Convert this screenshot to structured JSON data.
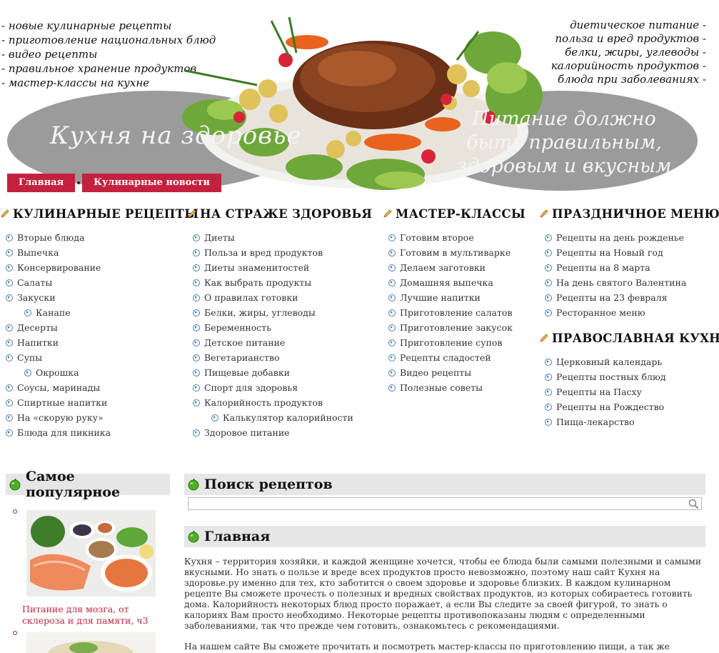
{
  "header": {
    "links_left": [
      "- новые кулинарные рецепты",
      "- приготовление национальных блюд",
      "- видео рецепты",
      "- правильное хранение продуктов",
      "- мастер-классы на кухне"
    ],
    "links_right": [
      "диетическое питание -",
      "польза и вред продуктов -",
      "белки, жиры, углеводы -",
      "калорийность продуктов -",
      "блюда при заболеваниях -"
    ],
    "site_title": "Кухня на здоровье",
    "slogan": "Питание должно быть правильным, здоровым и вкусным",
    "nav": {
      "home": "Главная",
      "news": "Кулинарные новости"
    }
  },
  "menu": {
    "recipes": {
      "title": "КУЛИНАРНЫЕ РЕЦЕПТЫ",
      "items": [
        "Вторые блюда",
        "Выпечка",
        "Консервирование",
        "Салаты",
        "Закуски",
        "Канапе",
        "Десерты",
        "Напитки",
        "Супы",
        "Окрошка",
        "Соусы, маринады",
        "Спиртные напитки",
        "На «скорую руку»",
        "Блюда для пикника"
      ]
    },
    "health": {
      "title": "НА СТРАЖЕ ЗДОРОВЬЯ",
      "items": [
        "Диеты",
        "Польза и вред продуктов",
        "Диеты знаменитостей",
        "Как выбрать продукты",
        "О правилах готовки",
        "Белки, жиры, углеводы",
        "Беременность",
        "Детское питание",
        "Вегетарианство",
        "Пищевые добавки",
        "Спорт для здоровья",
        "Калорийность продуктов",
        "Калькулятор калорийности",
        "Здоровое питание"
      ]
    },
    "masterclasses": {
      "title": "МАСТЕР-КЛАССЫ",
      "items": [
        "Готовим второе",
        "Готовим в мультиварке",
        "Делаем заготовки",
        "Домашняя выпечка",
        "Лучшие напитки",
        "Приготовление салатов",
        "Приготовление закусок",
        "Приготовление супов",
        "Рецепты сладостей",
        "Видео рецепты",
        "Полезные советы"
      ]
    },
    "holiday": {
      "title": "ПРАЗДНИЧНОЕ МЕНЮ",
      "items": [
        "Рецепты на день рожденье",
        "Рецепты на Новый год",
        "Рецепты на 8 марта",
        "На день святого Валентина",
        "Рецепты на 23 февраля",
        "Ресторанное меню"
      ]
    },
    "orthodox": {
      "title": "ПРАВОСЛАВНАЯ КУХНЯ",
      "items": [
        "Церковный календарь",
        "Рецепты постных блюд",
        "Рецепты на Пасху",
        "Рецепты на Рождество",
        "Пища-лекарство"
      ]
    }
  },
  "popular": {
    "title": "Самое популярное",
    "item1_caption": "Питание для мозга, от склероза и для памяти, ч3"
  },
  "search": {
    "title": "Поиск рецептов",
    "value": ""
  },
  "main": {
    "title": "Главная",
    "p1": "Кухня – территория хозяйки, и каждой женщине хочется, чтобы ее блюда были самыми полезными и самыми вкусными. Но знать о пользе и вреде всех продуктов просто невозможно, поэтому наш сайт Кухня на здоровье.ру именно для тех, кто заботится о своем здоровье и здоровье близких. В каждом кулинарном рецепте Вы сможете прочесть о полезных и вредных свойствах продуктов, из которых собираетесь готовить дома. Калорийность некоторых блюд просто поражает, а если Вы следите за своей фигурой, то знать о калориях Вам просто необходимо. Некоторые рецепты противопоказаны людям с определенными заболеваниями, так что прежде чем готовить, ознакомьтесь с рекомендациями.",
    "p2": "На нашем сайте Вы сможете прочитать и посмотреть мастер-классы по приготовлению пищи, а так же изучить видео"
  },
  "colors": {
    "accent": "#c4213f",
    "oval": "#9b9b9b",
    "box_bg": "#e6e6e6"
  }
}
